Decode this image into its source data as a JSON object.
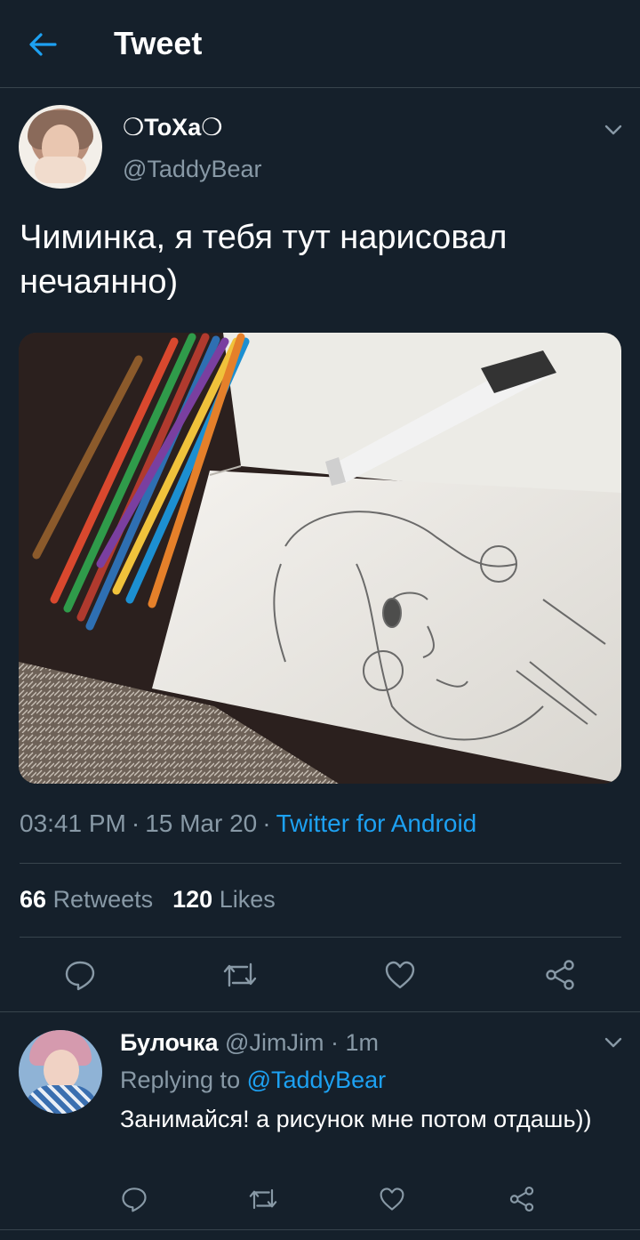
{
  "header": {
    "title": "Tweet"
  },
  "tweet": {
    "author_name": "❍ToXa❍",
    "author_handle": "@TaddyBear",
    "text": "Чиминка, я тебя тут нарисовал нечаянно)",
    "time": "03:41 PM",
    "date": "15 Mar 20",
    "source": "Twitter for Android",
    "retweets_count": "66",
    "retweets_label": "Retweets",
    "likes_count": "120",
    "likes_label": "Likes"
  },
  "reply": {
    "author_name": "Булочка",
    "author_handle": "@JimJim",
    "age": "1m",
    "replying_label": "Replying to",
    "replying_to": "@TaddyBear",
    "text": "Занимайся! а рисунок мне потом отдашь))"
  },
  "icons": {
    "back": "arrow-left-icon",
    "menu": "chevron-down-icon",
    "reply": "comment-icon",
    "retweet": "retweet-icon",
    "like": "heart-icon",
    "share": "share-icon"
  },
  "colors": {
    "background": "#15202b",
    "accent": "#1da1f2",
    "secondary_text": "#8899a6",
    "divider": "#38444d"
  }
}
